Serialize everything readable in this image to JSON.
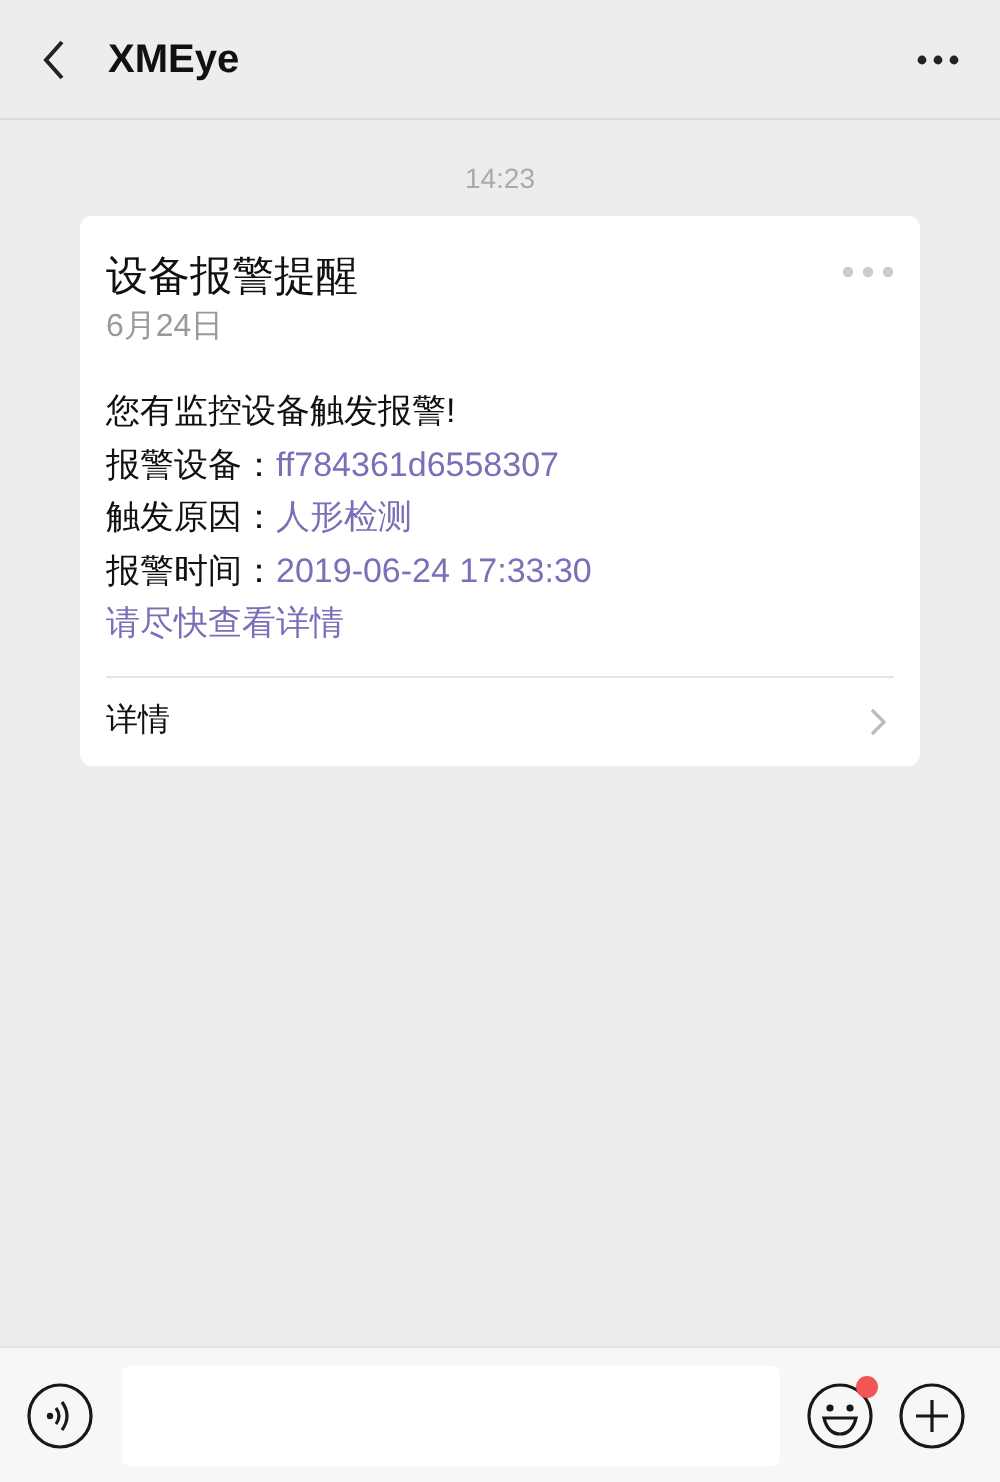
{
  "header": {
    "title": "XMEye"
  },
  "timestamp": "14:23",
  "card": {
    "title": "设备报警提醒",
    "date": "6月24日",
    "intro": "您有监控设备触发报警!",
    "fields": [
      {
        "label": "报警设备：",
        "value": "ff784361d6558307"
      },
      {
        "label": "触发原因：",
        "value": "人形检测"
      },
      {
        "label": "报警时间：",
        "value": "2019-06-24 17:33:30"
      }
    ],
    "link": "请尽快查看详情",
    "footer": "详情"
  },
  "input_bar": {
    "emoji_has_new": true
  }
}
